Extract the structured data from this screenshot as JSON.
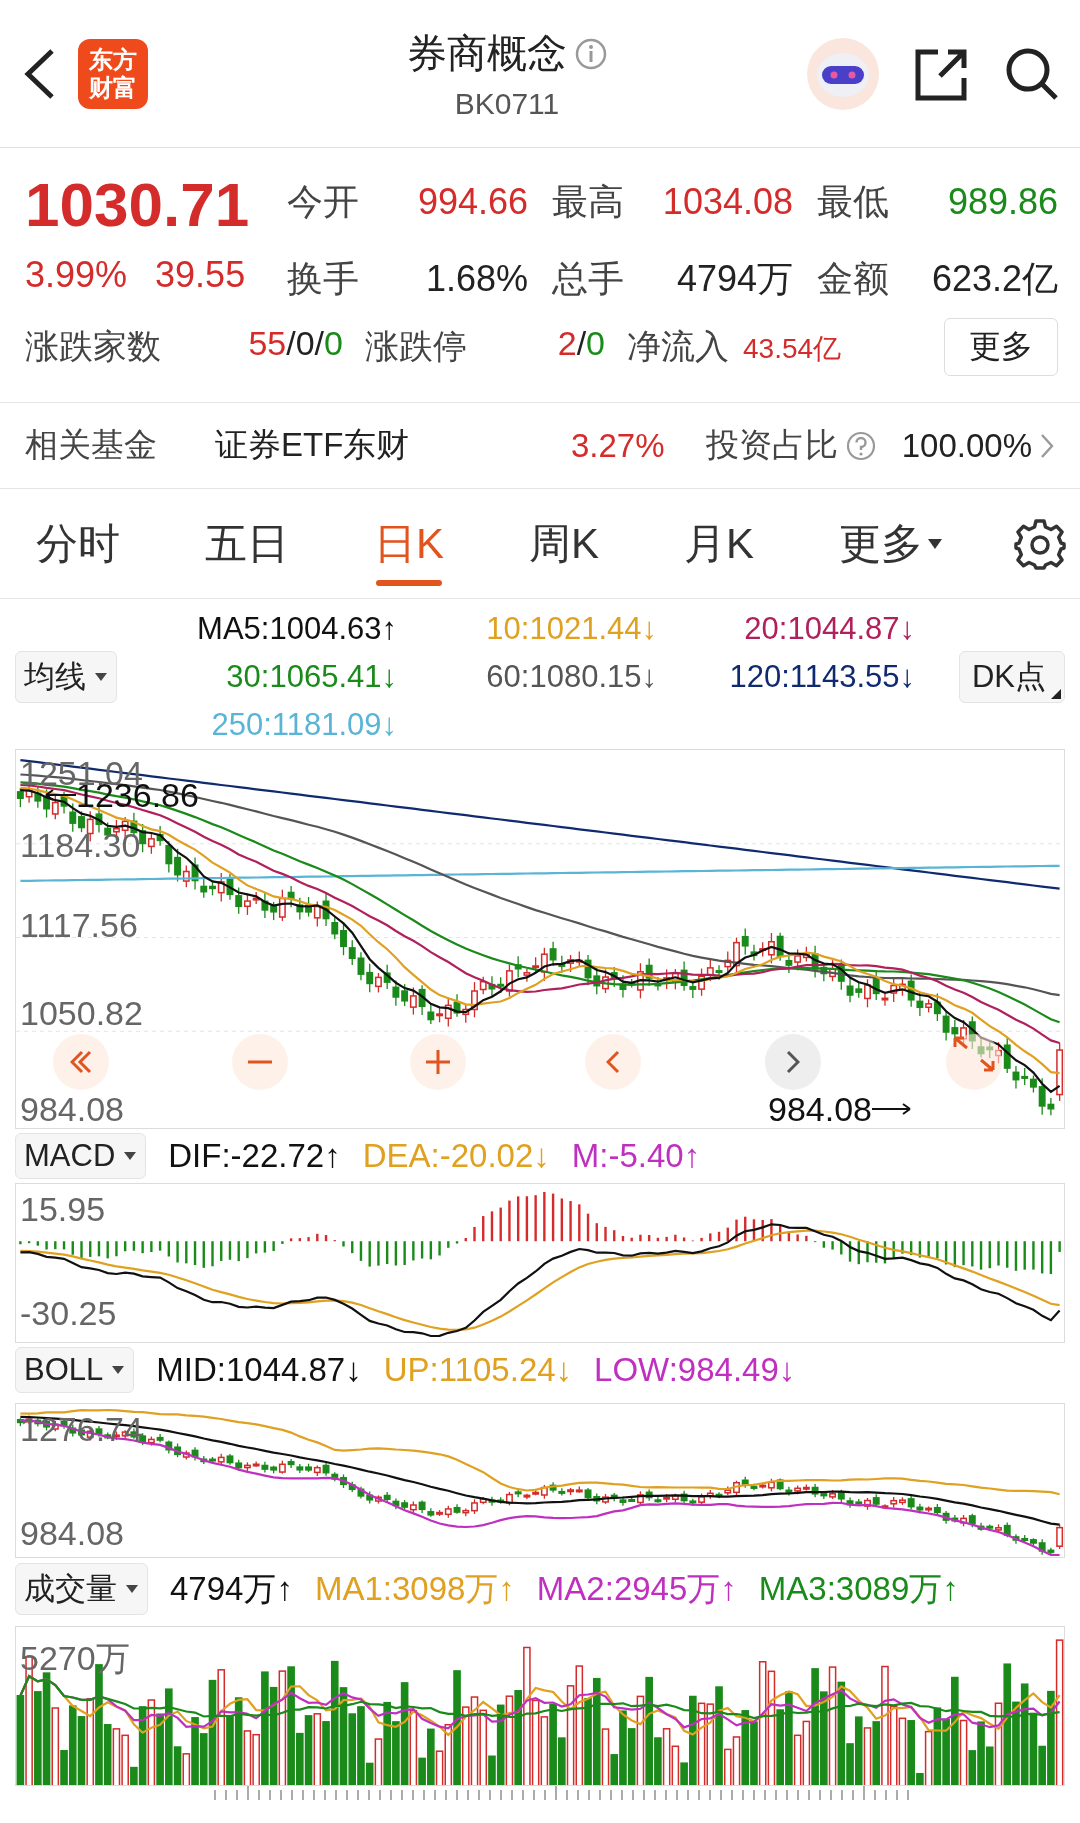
{
  "header": {
    "logo_lines": [
      "东方",
      "财富"
    ],
    "title": "券商概念",
    "code": "BK0711"
  },
  "quote": {
    "price": "1030.71",
    "change_pct": "3.99%",
    "change": "39.55",
    "stats": [
      {
        "label": "今开",
        "value": "994.66",
        "color": "#d42b2b"
      },
      {
        "label": "最高",
        "value": "1034.08",
        "color": "#d42b2b"
      },
      {
        "label": "最低",
        "value": "989.86",
        "color": "#1a8a1a"
      },
      {
        "label": "换手",
        "value": "1.68%",
        "color": "#222222"
      },
      {
        "label": "总手",
        "value": "4794万",
        "color": "#222222"
      },
      {
        "label": "金额",
        "value": "623.2亿",
        "color": "#222222"
      }
    ],
    "breadth": {
      "label": "涨跌家数",
      "parts": [
        {
          "text": "55",
          "color": "#d42b2b"
        },
        {
          "text": "/0/",
          "color": "#222222"
        },
        {
          "text": "0",
          "color": "#1a8a1a"
        }
      ]
    },
    "limit": {
      "label": "涨跌停",
      "parts": [
        {
          "text": "2",
          "color": "#d42b2b"
        },
        {
          "text": "/",
          "color": "#222222"
        },
        {
          "text": "0",
          "color": "#1a8a1a"
        }
      ]
    },
    "net_inflow": {
      "label": "净流入",
      "value": "43.54亿"
    },
    "more_button": "更多"
  },
  "fund": {
    "label": "相关基金",
    "name": "证券ETF东财",
    "change": "3.27%",
    "ratio_label": "投资占比",
    "ratio": "100.00%"
  },
  "tabs": [
    {
      "label": "分时",
      "selected": false,
      "kind": "tab"
    },
    {
      "label": "五日",
      "selected": false,
      "kind": "tab"
    },
    {
      "label": "日K",
      "selected": true,
      "kind": "tab"
    },
    {
      "label": "周K",
      "selected": false,
      "kind": "tab"
    },
    {
      "label": "月K",
      "selected": false,
      "kind": "tab"
    },
    {
      "label": "更多",
      "selected": false,
      "kind": "dropdown"
    }
  ],
  "ma_legend": {
    "selector": "均线",
    "dk_button": "DK点",
    "items": [
      {
        "text": "MA5:1004.63↑",
        "color": "#111111"
      },
      {
        "text": "10:1021.44↓",
        "color": "#e0a020"
      },
      {
        "text": "20:1044.87↓",
        "color": "#b0205a"
      },
      {
        "text": "30:1065.41↓",
        "color": "#1a8a1a"
      },
      {
        "text": "60:1080.15↓",
        "color": "#555555"
      },
      {
        "text": "120:1143.55↓",
        "color": "#102a70"
      },
      {
        "text": "250:1181.09↓",
        "color": "#5ab4d6"
      }
    ]
  },
  "main_chart": {
    "y_labels": [
      "1251.04",
      "1184.30",
      "1117.56",
      "1050.82",
      "984.08"
    ],
    "max_marker": "1236.86",
    "min_marker": "984.08"
  },
  "macd": {
    "selector": "MACD",
    "y_labels": [
      "15.95",
      "-30.25"
    ],
    "items": [
      {
        "text": "DIF:-22.72↑",
        "color": "#111111"
      },
      {
        "text": "DEA:-20.02↓",
        "color": "#e0a020"
      },
      {
        "text": "M:-5.40↑",
        "color": "#c030c0"
      }
    ]
  },
  "boll": {
    "selector": "BOLL",
    "y_labels": [
      "1276.74",
      "984.08"
    ],
    "items": [
      {
        "text": "MID:1044.87↓",
        "color": "#111111"
      },
      {
        "text": "UP:1105.24↓",
        "color": "#e0a020"
      },
      {
        "text": "LOW:984.49↓",
        "color": "#c030c0"
      }
    ]
  },
  "volume": {
    "selector": "成交量",
    "y_labels": [
      "5270万"
    ],
    "items": [
      {
        "text": "4794万↑",
        "color": "#111111"
      },
      {
        "text": "MA1:3098万↑",
        "color": "#e0a020"
      },
      {
        "text": "MA2:2945万↑",
        "color": "#c030c0"
      },
      {
        "text": "MA3:3089万↑",
        "color": "#1a8a1a"
      }
    ]
  }
}
